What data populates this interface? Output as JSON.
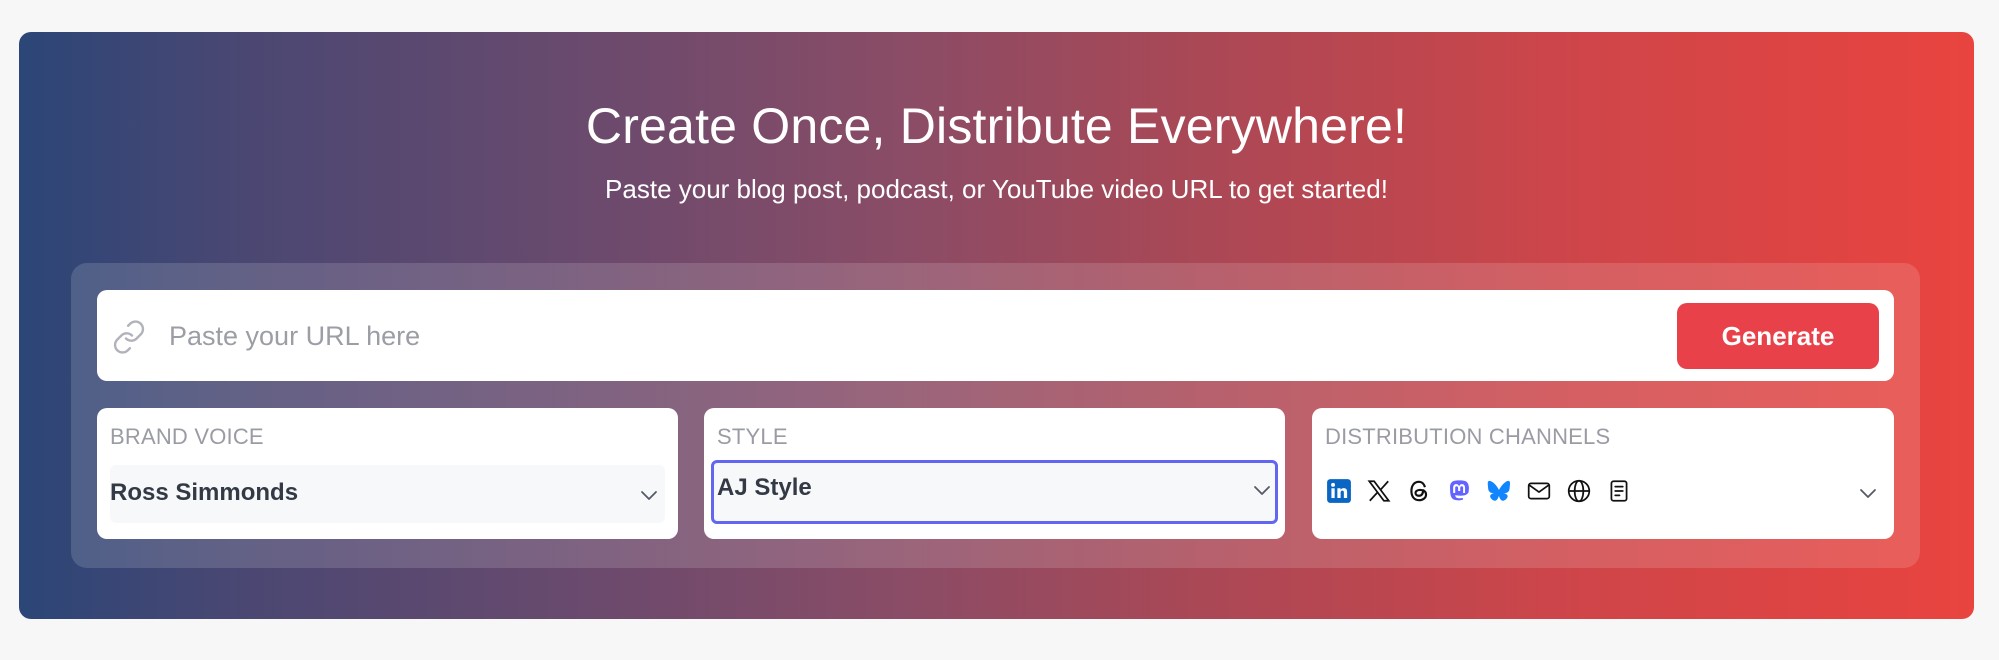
{
  "hero": {
    "title": "Create Once, Distribute Everywhere!",
    "subtitle": "Paste your blog post, podcast, or YouTube video URL to get started!"
  },
  "url_bar": {
    "placeholder": "Paste your URL here",
    "value": "",
    "icon": "link-icon",
    "generate_label": "Generate"
  },
  "brand_voice": {
    "label": "BRAND VOICE",
    "value": "Ross Simmonds"
  },
  "style": {
    "label": "STYLE",
    "value": "AJ Style"
  },
  "distribution": {
    "label": "DISTRIBUTION CHANNELS",
    "channels": [
      "linkedin-icon",
      "x-icon",
      "threads-icon",
      "mastodon-icon",
      "bluesky-icon",
      "email-icon",
      "globe-icon",
      "document-icon"
    ]
  },
  "colors": {
    "gradient_start": "#2b4677",
    "gradient_end": "#e9443f",
    "accent_button": "#e9414a",
    "focus_ring": "#6366f1",
    "linkedin": "#0a66c2",
    "mastodon": "#6364ff",
    "bluesky": "#1185fe"
  }
}
